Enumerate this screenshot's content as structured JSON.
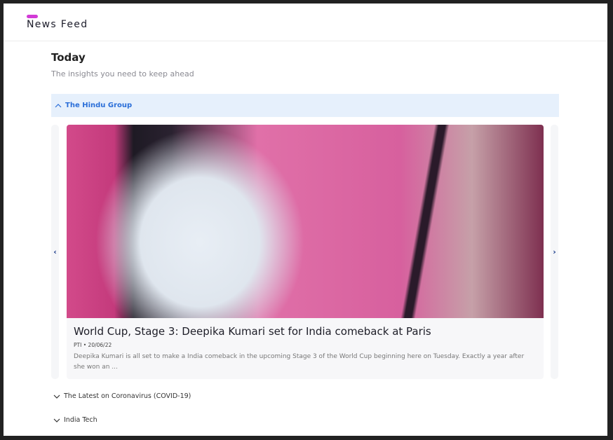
{
  "header": {
    "title": "News Feed",
    "accent": "#d23bd6"
  },
  "section": {
    "title": "Today",
    "subtitle": "The insights you need to keep ahead"
  },
  "groups": [
    {
      "label": "The Hindu Group",
      "expanded": true
    },
    {
      "label": "The Latest on Coronavirus (COVID-19)",
      "expanded": false
    },
    {
      "label": "India Tech",
      "expanded": false
    }
  ],
  "article": {
    "title": "World Cup, Stage 3: Deepika Kumari set for India comeback at Paris",
    "source": "PTI",
    "separator": "•",
    "date": "20/06/22",
    "excerpt": "Deepika Kumari is all set to make a India comeback in the upcoming Stage 3 of the World Cup beginning here on Tuesday. Exactly a year after she won an ..."
  },
  "carousel": {
    "prev": "‹",
    "next": "›"
  },
  "icons": {
    "up": "chevron-up-icon",
    "down": "chevron-down-icon"
  }
}
